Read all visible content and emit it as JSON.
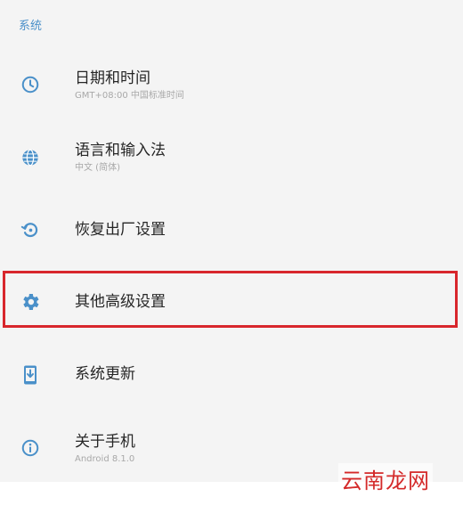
{
  "section": {
    "header": "系统"
  },
  "items": [
    {
      "icon": "clock-icon",
      "title": "日期和时间",
      "subtitle": "GMT+08:00 中国标准时间"
    },
    {
      "icon": "globe-icon",
      "title": "语言和输入法",
      "subtitle": "中文 (简体)"
    },
    {
      "icon": "restore-icon",
      "title": "恢复出厂设置",
      "subtitle": ""
    },
    {
      "icon": "gear-icon",
      "title": "其他高级设置",
      "subtitle": ""
    },
    {
      "icon": "system-update-icon",
      "title": "系统更新",
      "subtitle": ""
    },
    {
      "icon": "info-icon",
      "title": "关于手机",
      "subtitle": "Android 8.1.0"
    }
  ],
  "highlighted_item": "其他高级设置",
  "watermark": "云南龙网",
  "colors": {
    "accent": "#4a90c9",
    "highlight_border": "#d8262c",
    "title_text": "#262626",
    "subtitle_text": "#a8a8a8",
    "background": "#f4f4f4"
  }
}
